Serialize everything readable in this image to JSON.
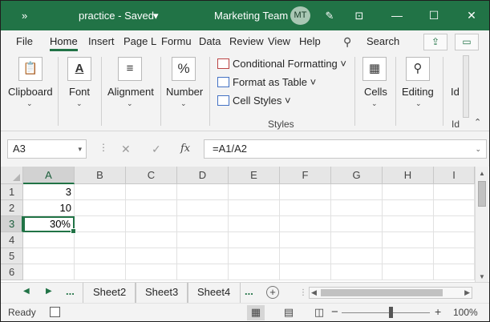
{
  "titlebar": {
    "quick_access_more": "»",
    "document_title": "practice  -  Saved",
    "title_chevron": "▾",
    "team": "Marketing Team",
    "avatar_initials": "MT",
    "pen_icon": "✎",
    "ribbon_display_icon": "⊡",
    "minimize_icon": "—",
    "maximize_icon": "☐",
    "close_icon": "✕"
  },
  "menu": {
    "tabs": [
      "File",
      "Home",
      "Insert",
      "Page L",
      "Formu",
      "Data",
      "Review",
      "View",
      "Help"
    ],
    "active_tab": "Home",
    "search_label": "Search",
    "search_icon": "⚲",
    "share_icon": "⇪",
    "comment_icon": "▭"
  },
  "ribbon": {
    "clipboard": {
      "label": "Clipboard",
      "icon": "📋",
      "caret": "⌄"
    },
    "font": {
      "label": "Font",
      "icon": "A",
      "caret": "⌄"
    },
    "alignment": {
      "label": "Alignment",
      "icon": "≡",
      "caret": "⌄"
    },
    "number": {
      "label": "Number",
      "icon": "%",
      "caret": "⌄"
    },
    "styles": {
      "conditional_formatting": "Conditional Formatting ˅",
      "format_as_table": "Format as Table ˅",
      "cell_styles": "Cell Styles ˅",
      "group_label": "Styles"
    },
    "cells": {
      "label": "Cells",
      "icon": "▦",
      "caret": "⌄"
    },
    "editing": {
      "label": "Editing",
      "icon": "⚲",
      "caret": "⌄"
    },
    "ideas": {
      "label": "Id",
      "group_label": "Id",
      "icon": "⚡"
    },
    "collapse_icon": "⌃"
  },
  "formula_bar": {
    "name_box": "A3",
    "name_box_dropdown": "▾",
    "separator": "⋮",
    "cancel_icon": "✕",
    "enter_icon": "✓",
    "fx_label": "fx",
    "formula": "=A1/A2",
    "formula_dropdown": "⌄"
  },
  "grid": {
    "columns": [
      "A",
      "B",
      "C",
      "D",
      "E",
      "F",
      "G",
      "H",
      "I"
    ],
    "rows": [
      "1",
      "2",
      "3",
      "4",
      "5",
      "6"
    ],
    "selected_column": "A",
    "selected_row": "3",
    "active_cell": "A3",
    "cells": {
      "A1": "3",
      "A2": "10",
      "A3": "30%"
    }
  },
  "sheets": {
    "prev_icon": "◀",
    "next_icon": "▶",
    "leading_dots": "...",
    "tabs": [
      "Sheet2",
      "Sheet3",
      "Sheet4"
    ],
    "trailing_dots": "...",
    "add_icon": "+"
  },
  "status": {
    "text": "Ready",
    "normal_view_icon": "▦",
    "page_layout_icon": "▤",
    "page_break_icon": "◫",
    "zoom_minus": "−",
    "zoom_plus": "+",
    "zoom_level": "100%",
    "zoom_fraction": 0.55
  },
  "colors": {
    "accent": "#217346"
  }
}
